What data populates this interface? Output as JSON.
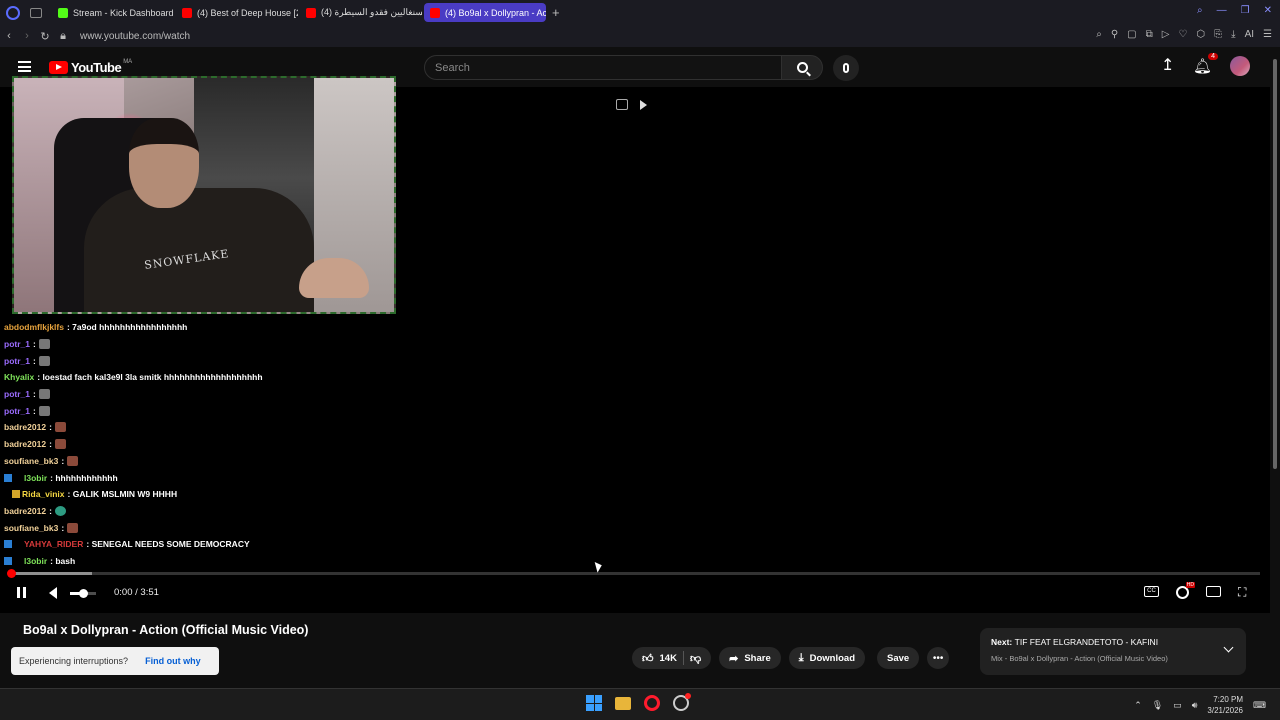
{
  "browser": {
    "tabs": [
      {
        "label": "Stream - Kick Dashboard",
        "fav_color": "#53fc18",
        "active": false
      },
      {
        "label": "(4) Best of Deep House [2",
        "fav_color": "#ff0000",
        "active": false
      },
      {
        "label": "(4) السنغاليين فقدو السيطرة",
        "fav_color": "#ff0000",
        "active": false
      },
      {
        "label": "(4) Bo9al x Dollypran - Act",
        "fav_color": "#ff0000",
        "active": true
      }
    ],
    "new_tab_label": "+",
    "url": "www.youtube.com/watch"
  },
  "youtube": {
    "logo_text": "YouTube",
    "country_code": "MA",
    "search_placeholder": "Search",
    "notification_count": "4"
  },
  "chat": [
    {
      "user": "abdodmflkjklfs",
      "user_color": "#e6a23c",
      "text": ": 7a9od hhhhhhhhhhhhhhhhh",
      "emote": null,
      "badge": null
    },
    {
      "user": "potr_1",
      "user_color": "#9b6cff",
      "text": ":",
      "emote": "grey",
      "badge": null
    },
    {
      "user": "potr_1",
      "user_color": "#9b6cff",
      "text": ":",
      "emote": "grey",
      "badge": null
    },
    {
      "user": "Khyalix",
      "user_color": "#7fe35a",
      "text": ": loestad fach kal3e9l 3la smitk hhhhhhhhhhhhhhhhhhh",
      "emote": null,
      "badge": null
    },
    {
      "user": "potr_1",
      "user_color": "#9b6cff",
      "text": ":",
      "emote": "grey",
      "badge": null
    },
    {
      "user": "potr_1",
      "user_color": "#9b6cff",
      "text": ":",
      "emote": "grey",
      "badge": null
    },
    {
      "user": "badre2012",
      "user_color": "#f2d29a",
      "text": ":",
      "emote": "brown",
      "badge": null
    },
    {
      "user": "badre2012",
      "user_color": "#f2d29a",
      "text": ":",
      "emote": "brown",
      "badge": null
    },
    {
      "user": "soufiane_bk3",
      "user_color": "#f2d29a",
      "text": ":",
      "emote": "brown",
      "badge": null
    },
    {
      "user": "l3obir",
      "user_color": "#7fe35a",
      "text": ": hhhhhhhhhhhh",
      "emote": null,
      "badge": "blue"
    },
    {
      "user": "Rida_vinix",
      "user_color": "#f5d742",
      "text": ": GALIK MSLMIN W9 HHHH",
      "emote": null,
      "badge": "gold"
    },
    {
      "user": "badre2012",
      "user_color": "#f2d29a",
      "text": ":",
      "emote": "teal",
      "badge": null
    },
    {
      "user": "soufiane_bk3",
      "user_color": "#f2d29a",
      "text": ":",
      "emote": "brown",
      "badge": null
    },
    {
      "user": "YAHYA_RIDER",
      "user_color": "#d63a3a",
      "text": ": SENEGAL NEEDS SOME DEMOCRACY",
      "emote": null,
      "badge": "blue"
    },
    {
      "user": "l3obir",
      "user_color": "#7fe35a",
      "text": ": bash",
      "emote": null,
      "badge": "blue"
    }
  ],
  "webcam": {
    "shirt_text": "SNOWFLAKE"
  },
  "player": {
    "time": "0:00 / 3:51",
    "progress_fraction": 0.0,
    "buffer_fraction": 0.065,
    "volume_fraction": 0.5,
    "cc_label": "CC"
  },
  "video": {
    "title": "Bo9al x Dollypran - Action (Official Music Video)",
    "likes": "14K",
    "share_label": "Share",
    "download_label": "Download",
    "save_label": "Save"
  },
  "toast": {
    "message": "Experiencing interruptions?",
    "link": "Find out why"
  },
  "up_next": {
    "prefix": "Next:",
    "title": "TIF FEAT ELGRANDETOTO - KAFINI",
    "subtitle": "Mix - Bo9al x Dollypran - Action (Official Music Video)"
  },
  "taskbar": {
    "time": "7:20 PM",
    "date": "3/21/2026"
  }
}
